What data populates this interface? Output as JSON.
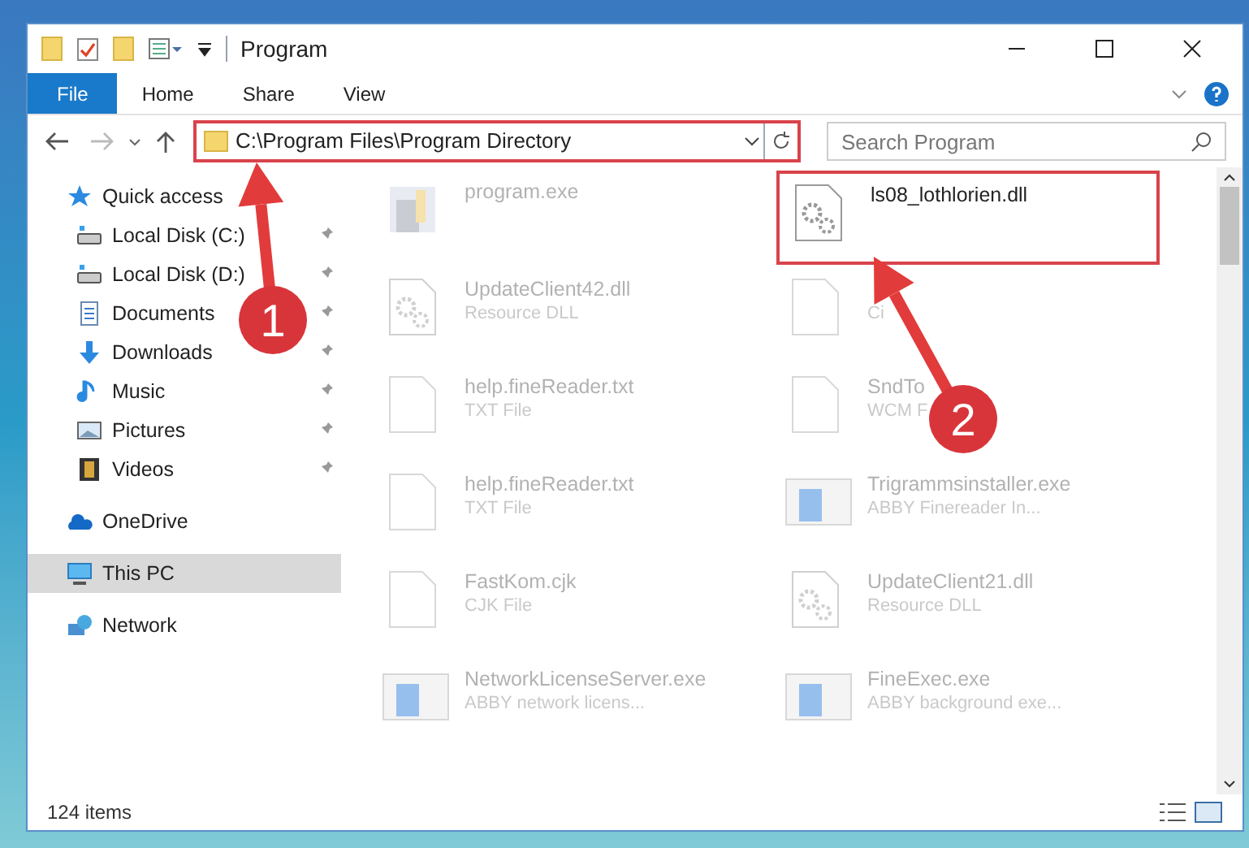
{
  "window": {
    "title": "Program"
  },
  "ribbon_tabs": [
    {
      "label": "File",
      "selected": true
    },
    {
      "label": "Home",
      "selected": false
    },
    {
      "label": "Share",
      "selected": false
    },
    {
      "label": "View",
      "selected": false
    }
  ],
  "address": {
    "path": "C:\\Program Files\\Program Directory",
    "highlighted": true
  },
  "search": {
    "placeholder": "Search Program"
  },
  "sidebar": {
    "items": [
      {
        "label": "Quick access",
        "kind": "star",
        "selected": false,
        "children": [
          {
            "label": "Local Disk (C:)",
            "kind": "disk",
            "pinned": true
          },
          {
            "label": "Local Disk (D:)",
            "kind": "disk",
            "pinned": true
          },
          {
            "label": "Documents",
            "kind": "doc",
            "pinned": true
          },
          {
            "label": "Downloads",
            "kind": "download",
            "pinned": true
          },
          {
            "label": "Music",
            "kind": "music",
            "pinned": true
          },
          {
            "label": "Pictures",
            "kind": "pictures",
            "pinned": true
          },
          {
            "label": "Videos",
            "kind": "videos",
            "pinned": true
          }
        ]
      },
      {
        "label": "OneDrive",
        "kind": "cloud",
        "selected": false
      },
      {
        "label": "This PC",
        "kind": "pc",
        "selected": true
      },
      {
        "label": "Network",
        "kind": "network",
        "selected": false
      }
    ]
  },
  "files": [
    {
      "name": "program.exe",
      "kind": "setup",
      "highlighted": false
    },
    {
      "name": "ls08_lothlorien.dll",
      "kind": "dll",
      "highlighted": true
    },
    {
      "name": "UpdateClient42.dll",
      "type": "Resource DLL",
      "kind": "dll",
      "highlighted": false
    },
    {
      "type": "Ci",
      "kind": "blank",
      "highlighted": false
    },
    {
      "name": "help.fineReader.txt",
      "type": "TXT File",
      "kind": "blank",
      "highlighted": false
    },
    {
      "name": "SndTo",
      "type": "WCM F",
      "kind": "blank",
      "highlighted": false
    },
    {
      "name": "help.fineReader.txt",
      "type": "TXT File",
      "kind": "blank",
      "highlighted": false
    },
    {
      "name": "Trigrammsinstaller.exe",
      "type": "ABBY Finereader In...",
      "kind": "app",
      "highlighted": false
    },
    {
      "name": "FastKom.cjk",
      "type": "CJK File",
      "kind": "blank",
      "highlighted": false
    },
    {
      "name": "UpdateClient21.dll",
      "type": "Resource DLL",
      "kind": "dll",
      "highlighted": false
    },
    {
      "name": "NetworkLicenseServer.exe",
      "type": "ABBY network licens...",
      "kind": "app",
      "highlighted": false
    },
    {
      "name": "FineExec.exe",
      "type": "ABBY background exe...",
      "kind": "app",
      "highlighted": false
    }
  ],
  "status_bar": {
    "count": "124 items"
  },
  "annotations": [
    {
      "label": "1"
    },
    {
      "label": "2"
    }
  ]
}
